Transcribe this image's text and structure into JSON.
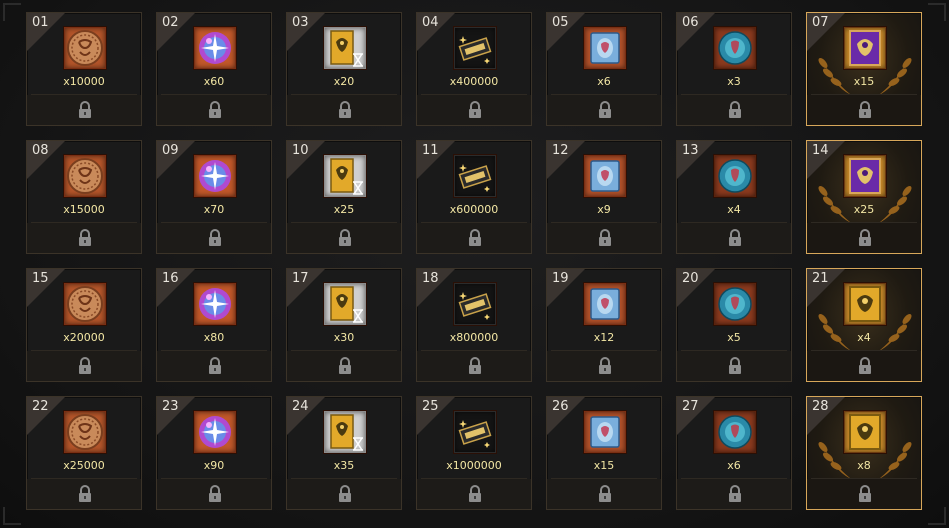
{
  "colors": {
    "accent_gold": "#d7a75a",
    "quantity_text": "#f2e6a4",
    "index_text": "#e8e4dc",
    "lock_gray": "#8d8d8d"
  },
  "slots": [
    {
      "index": "01",
      "item": "coin",
      "qty": "x10000",
      "special": false
    },
    {
      "index": "02",
      "item": "orb",
      "qty": "x60",
      "special": false
    },
    {
      "index": "03",
      "item": "hourglass-card",
      "qty": "x20",
      "special": false
    },
    {
      "index": "04",
      "item": "ticket",
      "qty": "x400000",
      "special": false
    },
    {
      "index": "05",
      "item": "scroll",
      "qty": "x6",
      "special": false
    },
    {
      "index": "06",
      "item": "shell",
      "qty": "x3",
      "special": false
    },
    {
      "index": "07",
      "item": "purple-card",
      "qty": "x15",
      "special": true
    },
    {
      "index": "08",
      "item": "coin",
      "qty": "x15000",
      "special": false
    },
    {
      "index": "09",
      "item": "orb",
      "qty": "x70",
      "special": false
    },
    {
      "index": "10",
      "item": "hourglass-card",
      "qty": "x25",
      "special": false
    },
    {
      "index": "11",
      "item": "ticket",
      "qty": "x600000",
      "special": false
    },
    {
      "index": "12",
      "item": "scroll",
      "qty": "x9",
      "special": false
    },
    {
      "index": "13",
      "item": "shell",
      "qty": "x4",
      "special": false
    },
    {
      "index": "14",
      "item": "purple-card",
      "qty": "x25",
      "special": true
    },
    {
      "index": "15",
      "item": "coin",
      "qty": "x20000",
      "special": false
    },
    {
      "index": "16",
      "item": "orb",
      "qty": "x80",
      "special": false
    },
    {
      "index": "17",
      "item": "hourglass-card",
      "qty": "x30",
      "special": false
    },
    {
      "index": "18",
      "item": "ticket",
      "qty": "x800000",
      "special": false
    },
    {
      "index": "19",
      "item": "scroll",
      "qty": "x12",
      "special": false
    },
    {
      "index": "20",
      "item": "shell",
      "qty": "x5",
      "special": false
    },
    {
      "index": "21",
      "item": "gold-card",
      "qty": "x4",
      "special": true
    },
    {
      "index": "22",
      "item": "coin",
      "qty": "x25000",
      "special": false
    },
    {
      "index": "23",
      "item": "orb",
      "qty": "x90",
      "special": false
    },
    {
      "index": "24",
      "item": "hourglass-card",
      "qty": "x35",
      "special": false
    },
    {
      "index": "25",
      "item": "ticket",
      "qty": "x1000000",
      "special": false
    },
    {
      "index": "26",
      "item": "scroll",
      "qty": "x15",
      "special": false
    },
    {
      "index": "27",
      "item": "shell",
      "qty": "x6",
      "special": false
    },
    {
      "index": "28",
      "item": "gold-card",
      "qty": "x8",
      "special": true
    }
  ]
}
